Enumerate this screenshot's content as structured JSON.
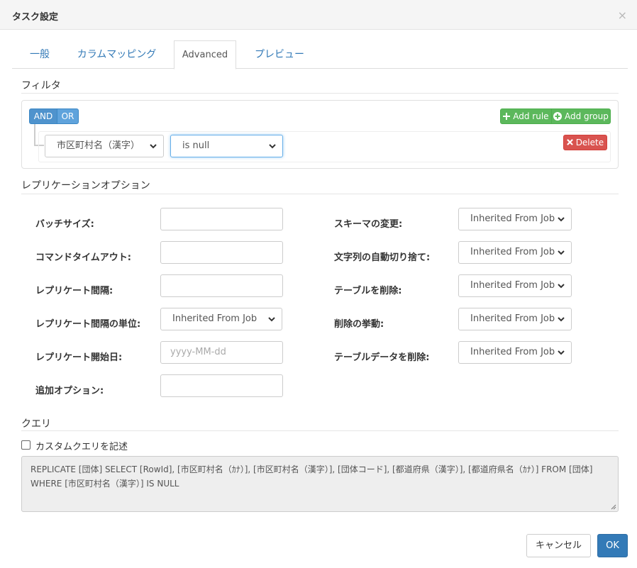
{
  "dialog": {
    "title": "タスク設定",
    "close_label": "×"
  },
  "tabs": [
    {
      "label": "一般",
      "active": false
    },
    {
      "label": "カラムマッピング",
      "active": false
    },
    {
      "label": "Advanced",
      "active": true
    },
    {
      "label": "プレビュー",
      "active": false
    }
  ],
  "filter": {
    "section_title": "フィルタ",
    "and_label": "AND",
    "or_label": "OR",
    "add_rule_label": "Add rule",
    "add_group_label": "Add group",
    "delete_label": "Delete",
    "rule": {
      "field": "市区町村名（漢字）",
      "operator": "is null"
    }
  },
  "replication": {
    "section_title": "レプリケーションオプション",
    "left": [
      {
        "label": "バッチサイズ:",
        "type": "input",
        "value": "",
        "placeholder": ""
      },
      {
        "label": "コマンドタイムアウト:",
        "type": "input",
        "value": "",
        "placeholder": ""
      },
      {
        "label": "レプリケート間隔:",
        "type": "input",
        "value": "",
        "placeholder": ""
      },
      {
        "label": "レプリケート間隔の単位:",
        "type": "select",
        "value": "Inherited From Job"
      },
      {
        "label": "レプリケート開始日:",
        "type": "input",
        "value": "",
        "placeholder": "yyyy-MM-dd"
      },
      {
        "label": "追加オプション:",
        "type": "input",
        "value": "",
        "placeholder": ""
      }
    ],
    "right": [
      {
        "label": "スキーマの変更:",
        "value": "Inherited From Job"
      },
      {
        "label": "文字列の自動切り捨て:",
        "value": "Inherited From Job"
      },
      {
        "label": "テーブルを削除:",
        "value": "Inherited From Job"
      },
      {
        "label": "削除の挙動:",
        "value": "Inherited From Job"
      },
      {
        "label": "テーブルデータを削除:",
        "value": "Inherited From Job"
      }
    ]
  },
  "query": {
    "section_title": "クエリ",
    "custom_query_label": "カスタムクエリを記述",
    "custom_query_checked": false,
    "text": "REPLICATE [団体] SELECT [RowId], [市区町村名（ｶﾅ）], [市区町村名（漢字）], [団体コード], [都道府県（漢字）], [都道府県名（ｶﾅ）] FROM [団体] WHERE [市区町村名（漢字）] IS NULL"
  },
  "footer": {
    "cancel_label": "キャンセル",
    "ok_label": "OK"
  },
  "colors": {
    "primary": "#337ab7",
    "success": "#5cb85c",
    "danger": "#d9534f",
    "and_or": "#4f93cd"
  }
}
